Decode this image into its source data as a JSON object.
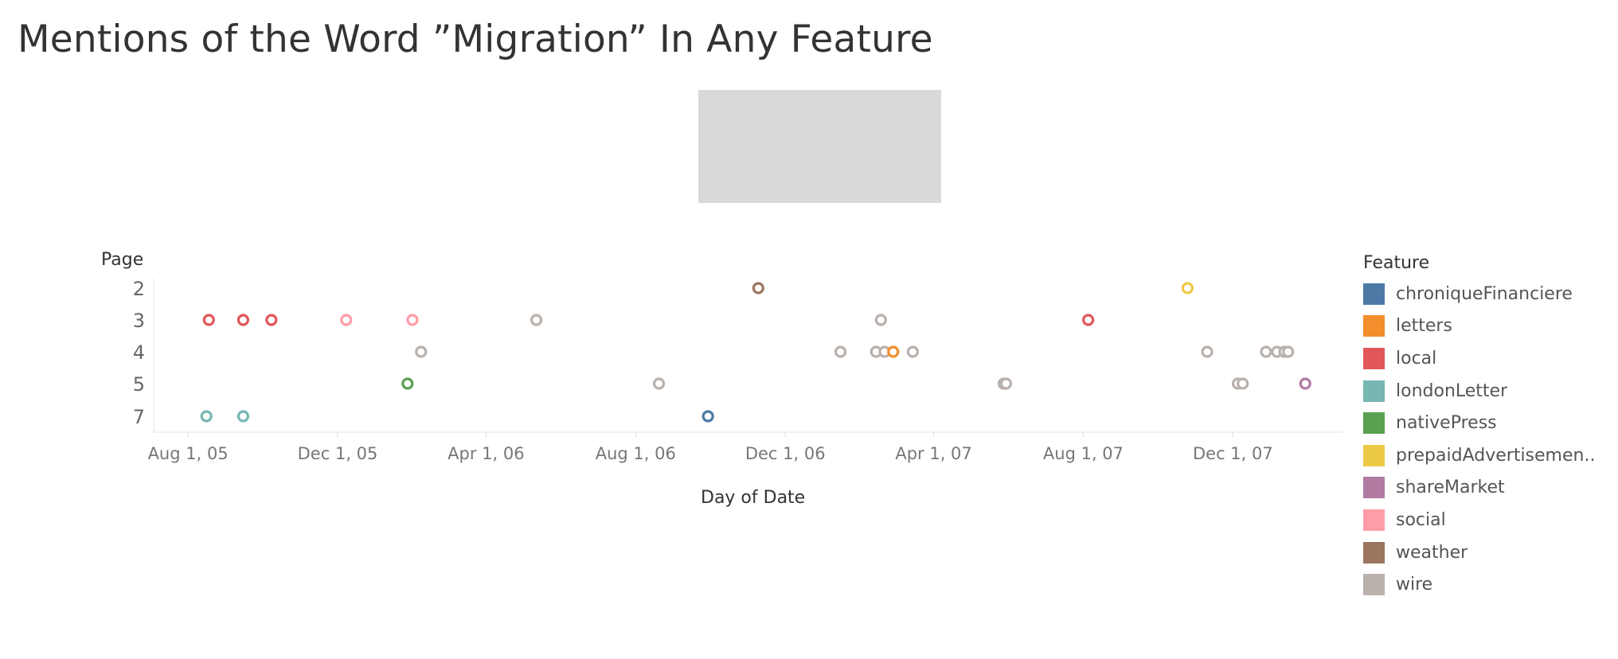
{
  "title": "Mentions of the Word ”Migration” In Any Feature",
  "chart_data": {
    "type": "scatter",
    "title": "Mentions of the Word ”Migration” In Any Feature",
    "xlabel": "Day of Date",
    "ylabel": "Page",
    "x_type": "date",
    "xlim": [
      "2005-07-04",
      "2008-02-29"
    ],
    "x_ticks": [
      {
        "date": "2005-08-01",
        "label": "Aug 1, 05"
      },
      {
        "date": "2005-12-01",
        "label": "Dec 1, 05"
      },
      {
        "date": "2006-04-01",
        "label": "Apr 1, 06"
      },
      {
        "date": "2006-08-01",
        "label": "Aug 1, 06"
      },
      {
        "date": "2006-12-01",
        "label": "Dec 1, 06"
      },
      {
        "date": "2007-04-01",
        "label": "Apr 1, 07"
      },
      {
        "date": "2007-08-01",
        "label": "Aug 1, 07"
      },
      {
        "date": "2007-12-01",
        "label": "Dec 1, 07"
      }
    ],
    "y_categories": [
      "2",
      "3",
      "4",
      "5",
      "7"
    ],
    "grid": false,
    "marker": "hollow-circle",
    "legend_title": "Feature",
    "legend_position": "right",
    "legend": [
      {
        "name": "chroniqueFinanciere",
        "color": "#4e79a7"
      },
      {
        "name": "letters",
        "color": "#f28e2b"
      },
      {
        "name": "local",
        "color": "#e15759"
      },
      {
        "name": "londonLetter",
        "color": "#76b7b2"
      },
      {
        "name": "nativePress",
        "color": "#59a14f"
      },
      {
        "name": "prepaidAdvertisemen..",
        "color": "#edc948"
      },
      {
        "name": "shareMarket",
        "color": "#b07aa1"
      },
      {
        "name": "social",
        "color": "#ff9da7"
      },
      {
        "name": "weather",
        "color": "#9c755f"
      },
      {
        "name": "wire",
        "color": "#bab0ac"
      }
    ],
    "points": [
      {
        "date": "2005-08-16",
        "page": "7",
        "feature": "londonLetter"
      },
      {
        "date": "2005-08-18",
        "page": "3",
        "feature": "local"
      },
      {
        "date": "2005-09-15",
        "page": "3",
        "feature": "local"
      },
      {
        "date": "2005-09-15",
        "page": "7",
        "feature": "londonLetter"
      },
      {
        "date": "2005-10-08",
        "page": "3",
        "feature": "local"
      },
      {
        "date": "2005-12-08",
        "page": "3",
        "feature": "social"
      },
      {
        "date": "2006-01-27",
        "page": "5",
        "feature": "nativePress"
      },
      {
        "date": "2006-01-31",
        "page": "3",
        "feature": "social"
      },
      {
        "date": "2006-02-07",
        "page": "4",
        "feature": "wire"
      },
      {
        "date": "2006-05-12",
        "page": "3",
        "feature": "wire"
      },
      {
        "date": "2006-08-20",
        "page": "5",
        "feature": "wire"
      },
      {
        "date": "2006-09-29",
        "page": "7",
        "feature": "chroniqueFinanciere"
      },
      {
        "date": "2006-11-09",
        "page": "2",
        "feature": "weather"
      },
      {
        "date": "2007-01-15",
        "page": "4",
        "feature": "wire"
      },
      {
        "date": "2007-02-13",
        "page": "4",
        "feature": "wire"
      },
      {
        "date": "2007-02-17",
        "page": "3",
        "feature": "wire"
      },
      {
        "date": "2007-02-20",
        "page": "4",
        "feature": "wire"
      },
      {
        "date": "2007-02-27",
        "page": "4",
        "feature": "letters"
      },
      {
        "date": "2007-03-15",
        "page": "4",
        "feature": "wire"
      },
      {
        "date": "2007-05-28",
        "page": "5",
        "feature": "wire"
      },
      {
        "date": "2007-05-30",
        "page": "5",
        "feature": "wire"
      },
      {
        "date": "2007-08-05",
        "page": "3",
        "feature": "local"
      },
      {
        "date": "2007-10-25",
        "page": "2",
        "feature": "prepaidAdvertisemen.."
      },
      {
        "date": "2007-11-10",
        "page": "4",
        "feature": "wire"
      },
      {
        "date": "2007-12-05",
        "page": "5",
        "feature": "wire"
      },
      {
        "date": "2007-12-09",
        "page": "5",
        "feature": "wire"
      },
      {
        "date": "2007-12-28",
        "page": "4",
        "feature": "wire"
      },
      {
        "date": "2008-01-06",
        "page": "4",
        "feature": "wire"
      },
      {
        "date": "2008-01-12",
        "page": "4",
        "feature": "wire"
      },
      {
        "date": "2008-01-15",
        "page": "4",
        "feature": "wire"
      },
      {
        "date": "2008-01-29",
        "page": "5",
        "feature": "shareMarket"
      }
    ]
  }
}
